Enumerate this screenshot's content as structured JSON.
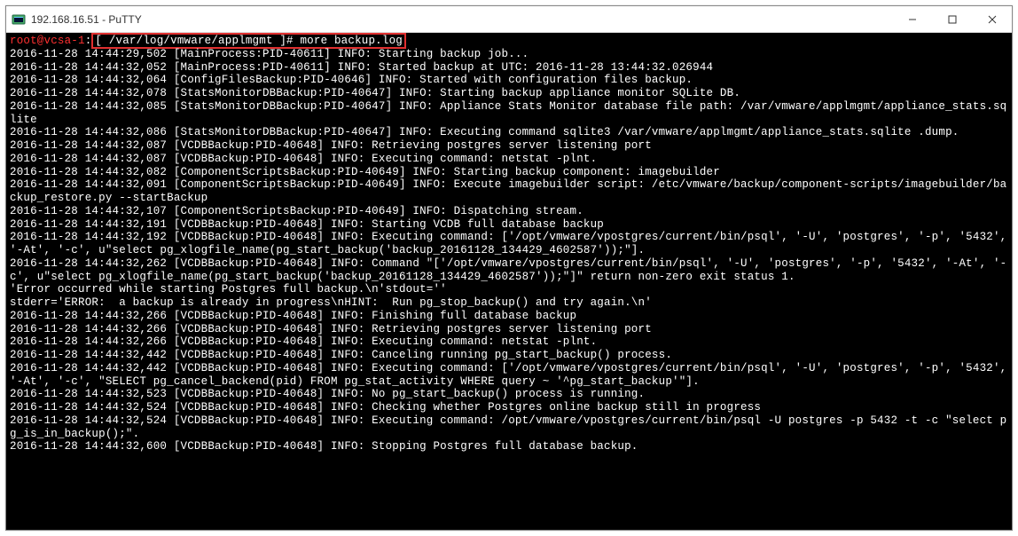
{
  "window": {
    "title": "192.168.16.51 - PuTTY"
  },
  "prompt": {
    "user": "root@vcsa-1",
    "path": "[ /var/log/vmware/applmgmt ]#",
    "command": "more backup.log"
  },
  "log_lines": [
    "2016-11-28 14:44:29,502 [MainProcess:PID-40611] INFO: Starting backup job...",
    "2016-11-28 14:44:32,052 [MainProcess:PID-40611] INFO: Started backup at UTC: 2016-11-28 13:44:32.026944",
    "2016-11-28 14:44:32,064 [ConfigFilesBackup:PID-40646] INFO: Started with configuration files backup.",
    "2016-11-28 14:44:32,078 [StatsMonitorDBBackup:PID-40647] INFO: Starting backup appliance monitor SQLite DB.",
    "2016-11-28 14:44:32,085 [StatsMonitorDBBackup:PID-40647] INFO: Appliance Stats Monitor database file path: /var/vmware/applmgmt/appliance_stats.sqlite",
    "2016-11-28 14:44:32,086 [StatsMonitorDBBackup:PID-40647] INFO: Executing command sqlite3 /var/vmware/applmgmt/appliance_stats.sqlite .dump.",
    "2016-11-28 14:44:32,087 [VCDBBackup:PID-40648] INFO: Retrieving postgres server listening port",
    "2016-11-28 14:44:32,087 [VCDBBackup:PID-40648] INFO: Executing command: netstat -plnt.",
    "2016-11-28 14:44:32,082 [ComponentScriptsBackup:PID-40649] INFO: Starting backup component: imagebuilder",
    "2016-11-28 14:44:32,091 [ComponentScriptsBackup:PID-40649] INFO: Execute imagebuilder script: /etc/vmware/backup/component-scripts/imagebuilder/backup_restore.py --startBackup",
    "2016-11-28 14:44:32,107 [ComponentScriptsBackup:PID-40649] INFO: Dispatching stream.",
    "2016-11-28 14:44:32,191 [VCDBBackup:PID-40648] INFO: Starting VCDB full database backup",
    "2016-11-28 14:44:32,192 [VCDBBackup:PID-40648] INFO: Executing command: ['/opt/vmware/vpostgres/current/bin/psql', '-U', 'postgres', '-p', '5432', '-At', '-c', u\"select pg_xlogfile_name(pg_start_backup('backup_20161128_134429_4602587'));\"].",
    "2016-11-28 14:44:32,262 [VCDBBackup:PID-40648] INFO: Command \"['/opt/vmware/vpostgres/current/bin/psql', '-U', 'postgres', '-p', '5432', '-At', '-c', u\"select pg_xlogfile_name(pg_start_backup('backup_20161128_134429_4602587'));\"]\" return non-zero exit status 1.",
    "'Error occurred while starting Postgres full backup.\\n'stdout=''",
    "stderr='ERROR:  a backup is already in progress\\nHINT:  Run pg_stop_backup() and try again.\\n'",
    "2016-11-28 14:44:32,266 [VCDBBackup:PID-40648] INFO: Finishing full database backup",
    "2016-11-28 14:44:32,266 [VCDBBackup:PID-40648] INFO: Retrieving postgres server listening port",
    "2016-11-28 14:44:32,266 [VCDBBackup:PID-40648] INFO: Executing command: netstat -plnt.",
    "2016-11-28 14:44:32,442 [VCDBBackup:PID-40648] INFO: Canceling running pg_start_backup() process.",
    "2016-11-28 14:44:32,442 [VCDBBackup:PID-40648] INFO: Executing command: ['/opt/vmware/vpostgres/current/bin/psql', '-U', 'postgres', '-p', '5432', '-At', '-c', \"SELECT pg_cancel_backend(pid) FROM pg_stat_activity WHERE query ~ '^pg_start_backup'\"].",
    "2016-11-28 14:44:32,523 [VCDBBackup:PID-40648] INFO: No pg_start_backup() process is running.",
    "2016-11-28 14:44:32,524 [VCDBBackup:PID-40648] INFO: Checking whether Postgres online backup still in progress",
    "2016-11-28 14:44:32,524 [VCDBBackup:PID-40648] INFO: Executing command: /opt/vmware/vpostgres/current/bin/psql -U postgres -p 5432 -t -c \"select pg_is_in_backup();\".",
    "2016-11-28 14:44:32,600 [VCDBBackup:PID-40648] INFO: Stopping Postgres full database backup."
  ]
}
